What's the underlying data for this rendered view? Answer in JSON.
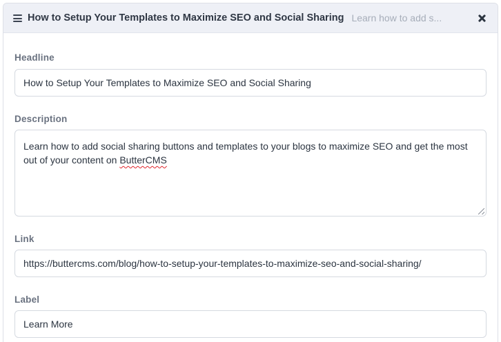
{
  "header": {
    "title": "How to Setup Your Templates to Maximize SEO and Social Sharing",
    "preview": "Learn how to add s..."
  },
  "fields": {
    "headline": {
      "label": "Headline",
      "value": "How to Setup Your Templates to Maximize SEO and Social Sharing"
    },
    "description": {
      "label": "Description",
      "value_text": "Learn how to add social sharing buttons and templates to your blogs to maximize SEO and get the most out of your content on ",
      "value_flagged_word": "ButterCMS"
    },
    "link": {
      "label": "Link",
      "value": "https://buttercms.com/blog/how-to-setup-your-templates-to-maximize-seo-and-social-sharing/"
    },
    "label": {
      "label": "Label",
      "value": "Learn More"
    }
  },
  "colors": {
    "header_bg": "#eef0f6",
    "label_text": "#6a7280",
    "border": "#d5d9e0",
    "spellcheck_underline": "#e0242b"
  },
  "icons": [
    "drag-handle-icon",
    "close-icon"
  ]
}
